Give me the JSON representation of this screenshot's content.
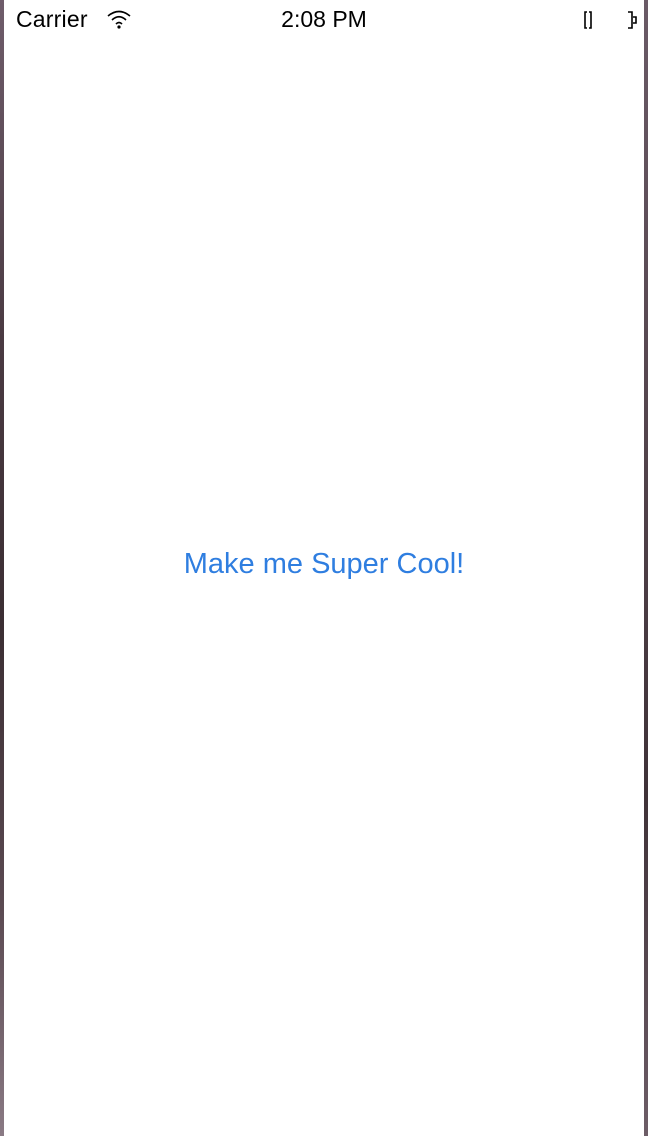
{
  "status_bar": {
    "carrier": "Carrier",
    "time": "2:08 PM",
    "wifi_icon": "wifi-icon",
    "battery_icon": "battery-icon"
  },
  "main": {
    "button_label": "Make me Super Cool!",
    "button_color": "#2f7ee0"
  }
}
